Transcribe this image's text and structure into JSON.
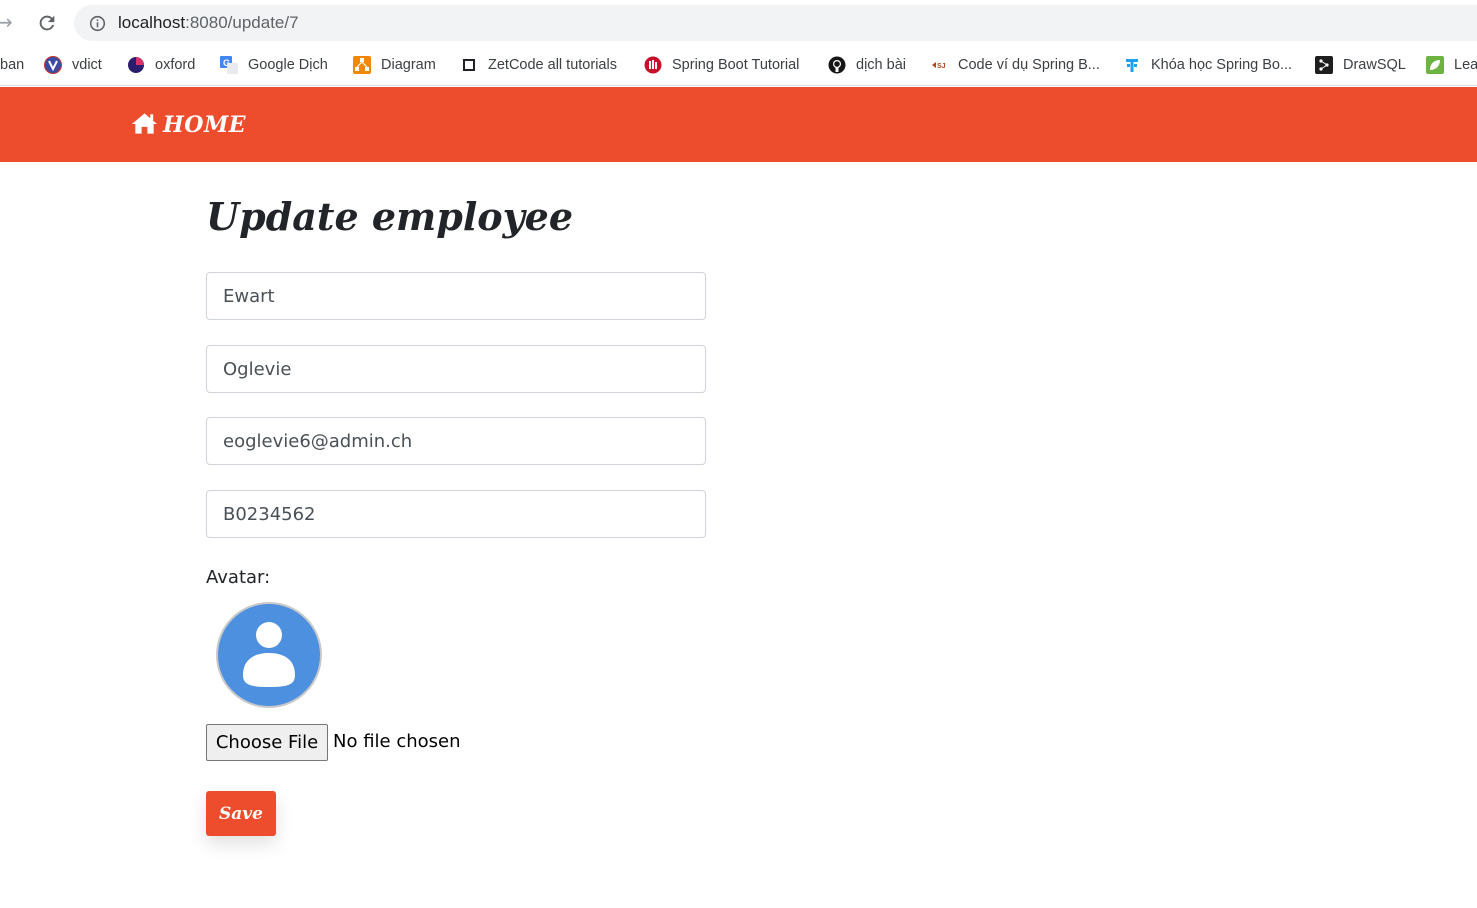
{
  "browser": {
    "url_host": "localhost",
    "url_path": ":8080/update/7",
    "bookmarks": [
      {
        "label": "ban",
        "icon": "partial-bookmark-icon"
      },
      {
        "label": "vdict",
        "icon": "vdict-icon"
      },
      {
        "label": "oxford",
        "icon": "oxford-icon"
      },
      {
        "label": "Google Dịch",
        "icon": "google-translate-icon"
      },
      {
        "label": "Diagram",
        "icon": "diagram-icon"
      },
      {
        "label": "ZetCode all tutorials",
        "icon": "zetcode-icon"
      },
      {
        "label": "Spring Boot Tutorial",
        "icon": "spring-boot-tutorial-icon"
      },
      {
        "label": "dịch bài",
        "icon": "github-icon"
      },
      {
        "label": "Code ví dụ Spring B...",
        "icon": "gpcoder-icon"
      },
      {
        "label": "Khóa học Spring Bo...",
        "icon": "course-icon"
      },
      {
        "label": "DrawSQL",
        "icon": "drawsql-icon"
      },
      {
        "label": "Lea",
        "icon": "leaf-icon"
      }
    ]
  },
  "navbar": {
    "brand_label": "HOME",
    "color": "#ee4d2d"
  },
  "form": {
    "title": "Update employee",
    "first_name": "Ewart",
    "last_name": "Oglevie",
    "email": "eoglevie6@admin.ch",
    "code": "B0234562",
    "avatar_label": "Avatar:",
    "avatar_icon": "user-avatar-icon",
    "file_button": "Choose File",
    "file_status": "No file chosen",
    "save_label": "Save"
  },
  "colors": {
    "accent": "#ee4d2d",
    "avatar_blue": "#4d90e0"
  }
}
